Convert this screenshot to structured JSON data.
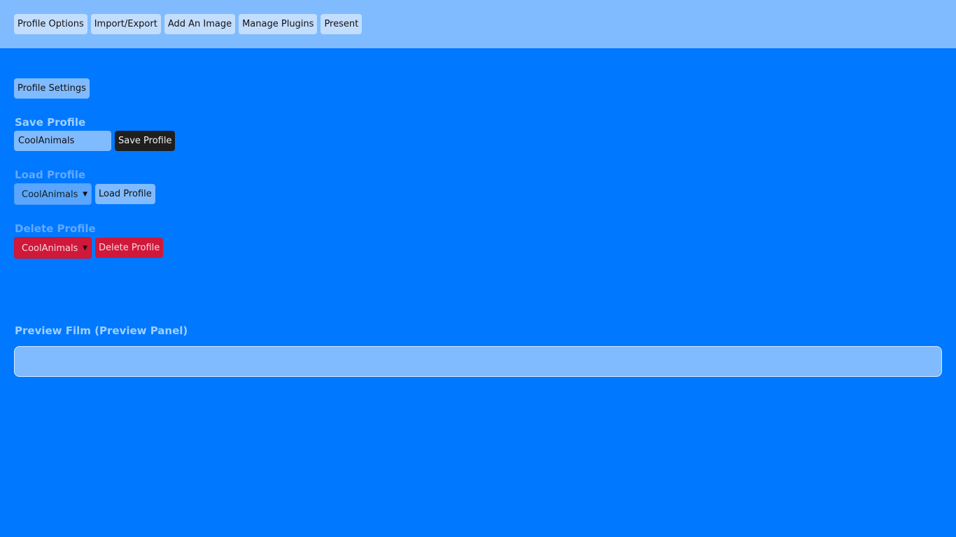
{
  "topnav": {
    "items": [
      {
        "label": "Profile Options"
      },
      {
        "label": "Import/Export"
      },
      {
        "label": "Add An Image"
      },
      {
        "label": "Manage Plugins"
      },
      {
        "label": "Present"
      }
    ]
  },
  "profile_settings_label": "Profile Settings",
  "save": {
    "heading": "Save Profile",
    "input_value": "CoolAnimals",
    "button_label": "Save Profile"
  },
  "load": {
    "heading": "Load Profile",
    "selected": "CoolAnimals",
    "button_label": "Load Profile"
  },
  "delete": {
    "heading": "Delete Profile",
    "selected": "CoolAnimals",
    "button_label": "Delete Profile"
  },
  "preview": {
    "heading": "Preview Film (Preview Panel)"
  },
  "colors": {
    "background": "#0078ff",
    "topbar": "#80bbff",
    "danger": "#d0183a",
    "dark_button": "#1f1f1f"
  }
}
